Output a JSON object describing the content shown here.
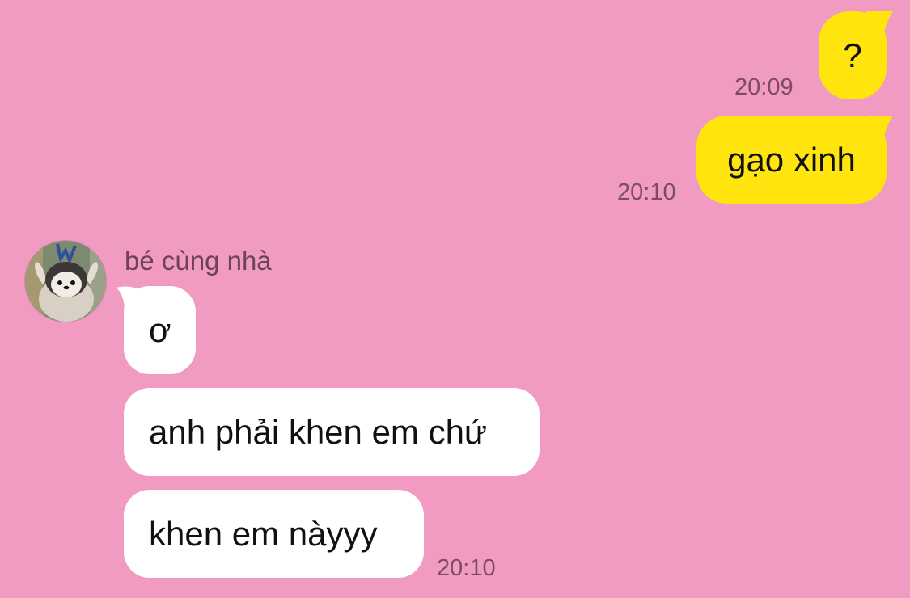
{
  "chat": {
    "colors": {
      "background": "#f29bc2",
      "outgoing_bubble": "#ffe40d",
      "incoming_bubble": "#ffffff",
      "timestamp_text": "#7b4d63"
    },
    "outgoing": [
      {
        "text": "?",
        "time": "20:09"
      },
      {
        "text": "gạo xinh",
        "time": "20:10"
      }
    ],
    "incoming": {
      "sender_name": "bé cùng nhà",
      "avatar_icon": "penguin-avatar",
      "messages": [
        {
          "text": "ơ"
        },
        {
          "text": "anh phải khen em chứ"
        },
        {
          "text": "khen em nàyyy",
          "time": "20:10"
        }
      ]
    }
  }
}
